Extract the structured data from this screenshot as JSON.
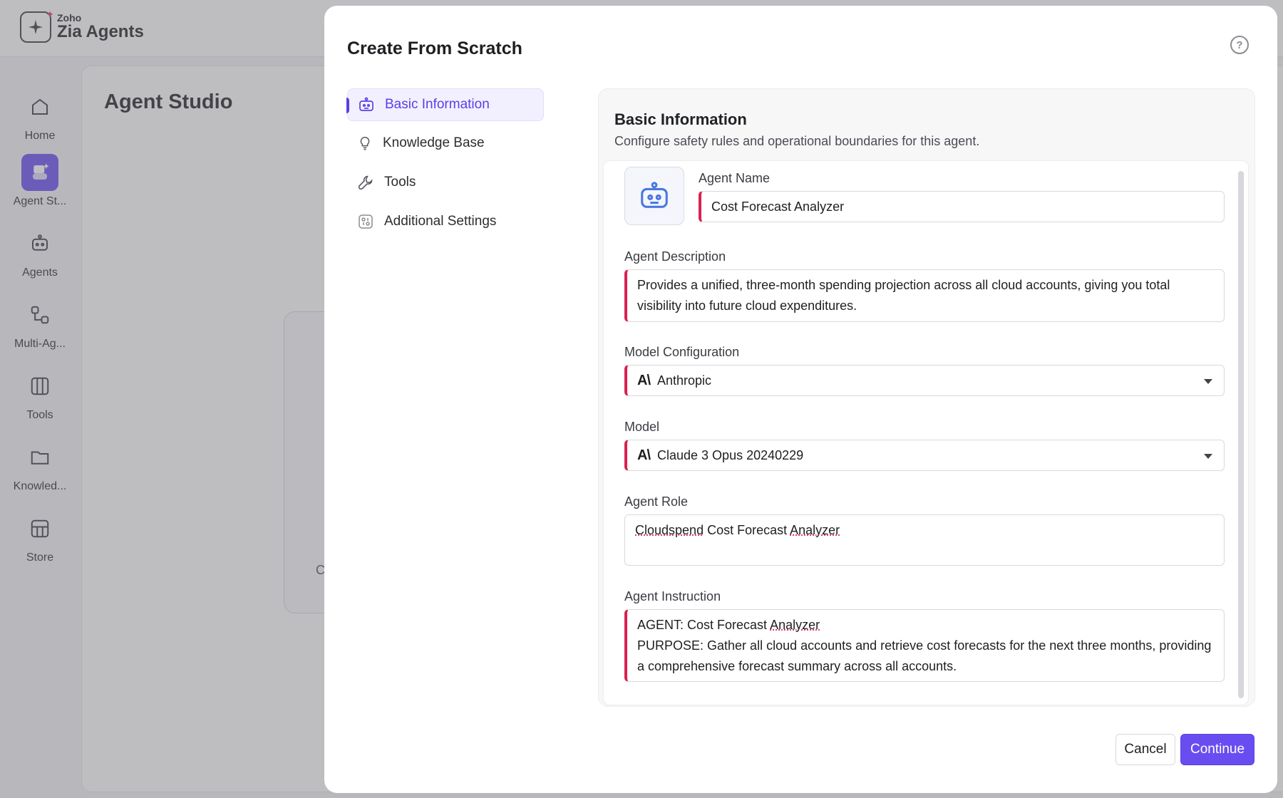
{
  "app": {
    "brand_small": "Zoho",
    "brand_name": "Zia Agents",
    "page_title": "Agent Studio",
    "ghost_text": "C",
    "nav": [
      {
        "label": "Home",
        "icon": "home-icon"
      },
      {
        "label": "Agent St...",
        "icon": "agent-studio-icon"
      },
      {
        "label": "Agents",
        "icon": "robot-icon"
      },
      {
        "label": "Multi-Ag...",
        "icon": "multi-agent-icon"
      },
      {
        "label": "Tools",
        "icon": "tools-icon"
      },
      {
        "label": "Knowled...",
        "icon": "folder-icon"
      },
      {
        "label": "Store",
        "icon": "store-icon"
      }
    ]
  },
  "modal": {
    "title": "Create From Scratch",
    "help": "?",
    "steps": [
      {
        "label": "Basic Information",
        "icon": "robot-icon",
        "active": true
      },
      {
        "label": "Knowledge Base",
        "icon": "bulb-icon",
        "active": false
      },
      {
        "label": "Tools",
        "icon": "wrench-icon",
        "active": false
      },
      {
        "label": "Additional Settings",
        "icon": "settings-icon",
        "active": false
      }
    ],
    "panel": {
      "title": "Basic Information",
      "subtitle": "Configure safety rules and operational boundaries for this agent."
    },
    "form": {
      "agent_name_label": "Agent Name",
      "agent_name_value": "Cost Forecast Analyzer",
      "description_label": "Agent Description",
      "description_value": "Provides a unified, three-month spending projection across all cloud accounts, giving you total visibility into future cloud expenditures.",
      "model_config_label": "Model Configuration",
      "model_config_value": "Anthropic",
      "model_label": "Model",
      "model_value": "Claude 3 Opus 20240229",
      "provider_logo": "A\\",
      "role_label": "Agent Role",
      "role_word1": "Cloudspend",
      "role_word2": " Cost Forecast ",
      "role_word3": "Analyzer",
      "instruction_label": "Agent Instruction",
      "instruction_line1_a": "AGENT: Cost Forecast ",
      "instruction_line1_b": "Analyzer",
      "instruction_line2": "PURPOSE: Gather all cloud accounts and retrieve cost forecasts for the next three months, providing a comprehensive forecast summary across all accounts."
    },
    "buttons": {
      "cancel": "Cancel",
      "continue": "Continue"
    }
  },
  "colors": {
    "accent": "#6a4df0",
    "required": "#d9224f"
  }
}
